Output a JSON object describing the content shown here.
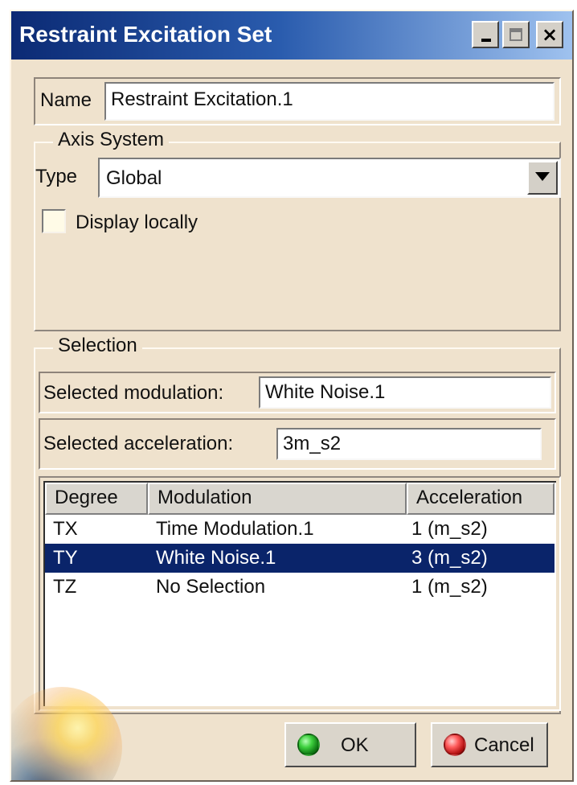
{
  "window": {
    "title": "Restraint Excitation Set"
  },
  "name_field": {
    "label": "Name",
    "value": "Restraint Excitation.1"
  },
  "axis_system": {
    "title": "Axis System",
    "type_label": "Type",
    "type_value": "Global",
    "display_locally_label": "Display locally"
  },
  "selection": {
    "title": "Selection",
    "selected_modulation_label": "Selected modulation:",
    "selected_modulation_value": "White Noise.1",
    "selected_acceleration_label": "Selected acceleration:",
    "selected_acceleration_value": "3m_s2",
    "table": {
      "headers": [
        "Degree",
        "Modulation",
        "Acceleration"
      ],
      "rows": [
        [
          "TX",
          "Time Modulation.1",
          "1 (m_s2)"
        ],
        [
          "TY",
          "White Noise.1",
          "3 (m_s2)"
        ],
        [
          "TZ",
          "No Selection",
          "1 (m_s2)"
        ]
      ]
    }
  },
  "buttons": {
    "ok": "OK",
    "cancel": "Cancel"
  },
  "icons": {
    "minimize": "minimize-icon",
    "maximize": "maximize-icon",
    "close": "close-icon",
    "dropdown": "chevron-down-icon",
    "ok": "green-ball-icon",
    "cancel": "red-ball-icon"
  },
  "colors": {
    "title_start": "#0b2a74",
    "title_end": "#9fc2ef",
    "panel": "#efe2cd",
    "selected_row": "#0a246a"
  }
}
